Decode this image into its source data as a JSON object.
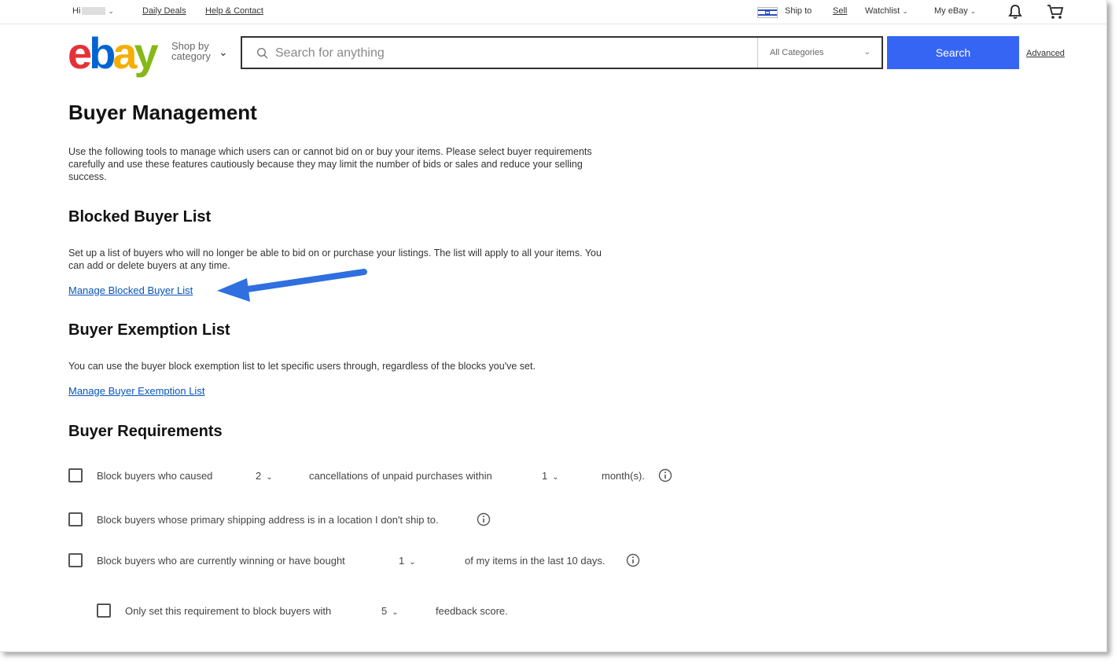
{
  "topbar": {
    "greeting": "Hi",
    "daily_deals": "Daily Deals",
    "help_contact": "Help & Contact",
    "ship_to": "Ship to",
    "sell": "Sell",
    "watchlist": "Watchlist",
    "my_ebay": "My eBay"
  },
  "header": {
    "logo": {
      "e": "e",
      "b": "b",
      "a": "a",
      "y": "y"
    },
    "shop_by_category": "Shop by category",
    "search_placeholder": "Search for anything",
    "category_select": "All Categories",
    "search_button": "Search",
    "advanced": "Advanced"
  },
  "page": {
    "title": "Buyer Management",
    "intro": "Use the following tools to manage which users can or cannot bid on or buy your items. Please select buyer requirements carefully and use these features cautiously because they may limit the number of bids or sales and reduce your selling success.",
    "blocked": {
      "heading": "Blocked Buyer List",
      "text": "Set up a list of buyers who will no longer be able to bid on or purchase your listings. The list will apply to all your items. You can add or delete buyers at any time.",
      "link": "Manage Blocked Buyer List"
    },
    "exemption": {
      "heading": "Buyer Exemption List",
      "text": "You can use the buyer block exemption list to let specific users through, regardless of the blocks you've set.",
      "link": "Manage Buyer Exemption List"
    },
    "requirements": {
      "heading": "Buyer Requirements",
      "row1": {
        "text1": "Block buyers who caused",
        "select1": "2",
        "text2": "cancellations of unpaid purchases within",
        "select2": "1",
        "text3": "month(s)."
      },
      "row2": {
        "text1": "Block buyers whose primary shipping address is in a location I don't ship to."
      },
      "row3": {
        "text1": "Block buyers who are currently winning or have bought",
        "select1": "1",
        "text2": "of my items in the last 10 days."
      },
      "row4": {
        "text1": "Only set this requirement to block buyers with",
        "select1": "5",
        "text2": "feedback score."
      }
    }
  },
  "colors": {
    "search_button": "#3665f3",
    "link": "#0654ba",
    "annotation_arrow": "#2f6fdf"
  }
}
